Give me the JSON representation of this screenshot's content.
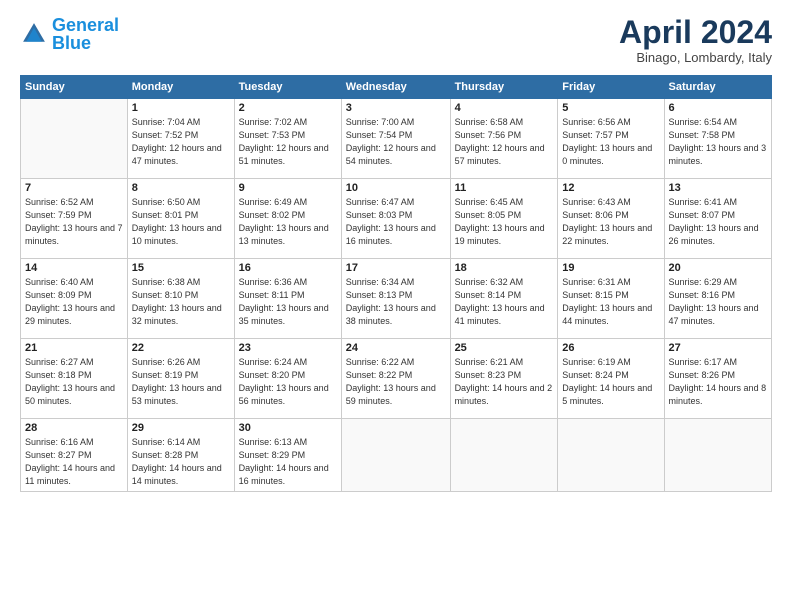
{
  "logo": {
    "line1": "General",
    "line2": "Blue"
  },
  "title": "April 2024",
  "location": "Binago, Lombardy, Italy",
  "weekdays": [
    "Sunday",
    "Monday",
    "Tuesday",
    "Wednesday",
    "Thursday",
    "Friday",
    "Saturday"
  ],
  "weeks": [
    [
      {
        "day": "",
        "sunrise": "",
        "sunset": "",
        "daylight": ""
      },
      {
        "day": "1",
        "sunrise": "Sunrise: 7:04 AM",
        "sunset": "Sunset: 7:52 PM",
        "daylight": "Daylight: 12 hours and 47 minutes."
      },
      {
        "day": "2",
        "sunrise": "Sunrise: 7:02 AM",
        "sunset": "Sunset: 7:53 PM",
        "daylight": "Daylight: 12 hours and 51 minutes."
      },
      {
        "day": "3",
        "sunrise": "Sunrise: 7:00 AM",
        "sunset": "Sunset: 7:54 PM",
        "daylight": "Daylight: 12 hours and 54 minutes."
      },
      {
        "day": "4",
        "sunrise": "Sunrise: 6:58 AM",
        "sunset": "Sunset: 7:56 PM",
        "daylight": "Daylight: 12 hours and 57 minutes."
      },
      {
        "day": "5",
        "sunrise": "Sunrise: 6:56 AM",
        "sunset": "Sunset: 7:57 PM",
        "daylight": "Daylight: 13 hours and 0 minutes."
      },
      {
        "day": "6",
        "sunrise": "Sunrise: 6:54 AM",
        "sunset": "Sunset: 7:58 PM",
        "daylight": "Daylight: 13 hours and 3 minutes."
      }
    ],
    [
      {
        "day": "7",
        "sunrise": "Sunrise: 6:52 AM",
        "sunset": "Sunset: 7:59 PM",
        "daylight": "Daylight: 13 hours and 7 minutes."
      },
      {
        "day": "8",
        "sunrise": "Sunrise: 6:50 AM",
        "sunset": "Sunset: 8:01 PM",
        "daylight": "Daylight: 13 hours and 10 minutes."
      },
      {
        "day": "9",
        "sunrise": "Sunrise: 6:49 AM",
        "sunset": "Sunset: 8:02 PM",
        "daylight": "Daylight: 13 hours and 13 minutes."
      },
      {
        "day": "10",
        "sunrise": "Sunrise: 6:47 AM",
        "sunset": "Sunset: 8:03 PM",
        "daylight": "Daylight: 13 hours and 16 minutes."
      },
      {
        "day": "11",
        "sunrise": "Sunrise: 6:45 AM",
        "sunset": "Sunset: 8:05 PM",
        "daylight": "Daylight: 13 hours and 19 minutes."
      },
      {
        "day": "12",
        "sunrise": "Sunrise: 6:43 AM",
        "sunset": "Sunset: 8:06 PM",
        "daylight": "Daylight: 13 hours and 22 minutes."
      },
      {
        "day": "13",
        "sunrise": "Sunrise: 6:41 AM",
        "sunset": "Sunset: 8:07 PM",
        "daylight": "Daylight: 13 hours and 26 minutes."
      }
    ],
    [
      {
        "day": "14",
        "sunrise": "Sunrise: 6:40 AM",
        "sunset": "Sunset: 8:09 PM",
        "daylight": "Daylight: 13 hours and 29 minutes."
      },
      {
        "day": "15",
        "sunrise": "Sunrise: 6:38 AM",
        "sunset": "Sunset: 8:10 PM",
        "daylight": "Daylight: 13 hours and 32 minutes."
      },
      {
        "day": "16",
        "sunrise": "Sunrise: 6:36 AM",
        "sunset": "Sunset: 8:11 PM",
        "daylight": "Daylight: 13 hours and 35 minutes."
      },
      {
        "day": "17",
        "sunrise": "Sunrise: 6:34 AM",
        "sunset": "Sunset: 8:13 PM",
        "daylight": "Daylight: 13 hours and 38 minutes."
      },
      {
        "day": "18",
        "sunrise": "Sunrise: 6:32 AM",
        "sunset": "Sunset: 8:14 PM",
        "daylight": "Daylight: 13 hours and 41 minutes."
      },
      {
        "day": "19",
        "sunrise": "Sunrise: 6:31 AM",
        "sunset": "Sunset: 8:15 PM",
        "daylight": "Daylight: 13 hours and 44 minutes."
      },
      {
        "day": "20",
        "sunrise": "Sunrise: 6:29 AM",
        "sunset": "Sunset: 8:16 PM",
        "daylight": "Daylight: 13 hours and 47 minutes."
      }
    ],
    [
      {
        "day": "21",
        "sunrise": "Sunrise: 6:27 AM",
        "sunset": "Sunset: 8:18 PM",
        "daylight": "Daylight: 13 hours and 50 minutes."
      },
      {
        "day": "22",
        "sunrise": "Sunrise: 6:26 AM",
        "sunset": "Sunset: 8:19 PM",
        "daylight": "Daylight: 13 hours and 53 minutes."
      },
      {
        "day": "23",
        "sunrise": "Sunrise: 6:24 AM",
        "sunset": "Sunset: 8:20 PM",
        "daylight": "Daylight: 13 hours and 56 minutes."
      },
      {
        "day": "24",
        "sunrise": "Sunrise: 6:22 AM",
        "sunset": "Sunset: 8:22 PM",
        "daylight": "Daylight: 13 hours and 59 minutes."
      },
      {
        "day": "25",
        "sunrise": "Sunrise: 6:21 AM",
        "sunset": "Sunset: 8:23 PM",
        "daylight": "Daylight: 14 hours and 2 minutes."
      },
      {
        "day": "26",
        "sunrise": "Sunrise: 6:19 AM",
        "sunset": "Sunset: 8:24 PM",
        "daylight": "Daylight: 14 hours and 5 minutes."
      },
      {
        "day": "27",
        "sunrise": "Sunrise: 6:17 AM",
        "sunset": "Sunset: 8:26 PM",
        "daylight": "Daylight: 14 hours and 8 minutes."
      }
    ],
    [
      {
        "day": "28",
        "sunrise": "Sunrise: 6:16 AM",
        "sunset": "Sunset: 8:27 PM",
        "daylight": "Daylight: 14 hours and 11 minutes."
      },
      {
        "day": "29",
        "sunrise": "Sunrise: 6:14 AM",
        "sunset": "Sunset: 8:28 PM",
        "daylight": "Daylight: 14 hours and 14 minutes."
      },
      {
        "day": "30",
        "sunrise": "Sunrise: 6:13 AM",
        "sunset": "Sunset: 8:29 PM",
        "daylight": "Daylight: 14 hours and 16 minutes."
      },
      {
        "day": "",
        "sunrise": "",
        "sunset": "",
        "daylight": ""
      },
      {
        "day": "",
        "sunrise": "",
        "sunset": "",
        "daylight": ""
      },
      {
        "day": "",
        "sunrise": "",
        "sunset": "",
        "daylight": ""
      },
      {
        "day": "",
        "sunrise": "",
        "sunset": "",
        "daylight": ""
      }
    ]
  ]
}
